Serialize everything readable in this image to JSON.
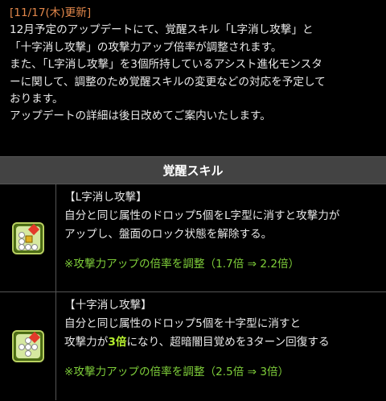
{
  "update": {
    "tag": "[11/17(木)更新]",
    "lines": [
      "12月予定のアップデートにて、覚醒スキル「L字消し攻撃」と",
      "「十字消し攻撃」の攻撃力アップ倍率が調整されます。",
      "また、「L字消し攻撃」を3個所持しているアシスト進化モンスタ",
      "ーに関して、調整のため覚醒スキルの変更などの対応を予定して",
      "おります。",
      "アップデートの詳細は後日改めてご案内いたします。"
    ]
  },
  "table": {
    "header": "覚醒スキル",
    "rows": [
      {
        "icon": "l-shape-icon",
        "title": "【L字消し攻撃】",
        "desc": [
          "自分と同じ属性のドロップ5個をL字型に消すと攻撃力が",
          "アップし、盤面のロック状態を解除する。"
        ],
        "note": "※攻撃力アップの倍率を調整（1.7倍 ⇒ 2.2倍）"
      },
      {
        "icon": "cross-shape-icon",
        "title": "【十字消し攻撃】",
        "desc_line1": "自分と同じ属性のドロップ5個を十字型に消すと",
        "desc_line2_pre": "攻撃力が",
        "desc_line2_hl": "3倍",
        "desc_line2_post": "になり、超暗闇目覚めを3ターン回復する",
        "note": "※攻撃力アップの倍率を調整（2.5倍 ⇒ 3倍）"
      }
    ]
  },
  "colors": {
    "tag": "#e0864a",
    "note": "#7fcf3a",
    "highlight": "#b6f02e",
    "header_bg": "#434343"
  }
}
